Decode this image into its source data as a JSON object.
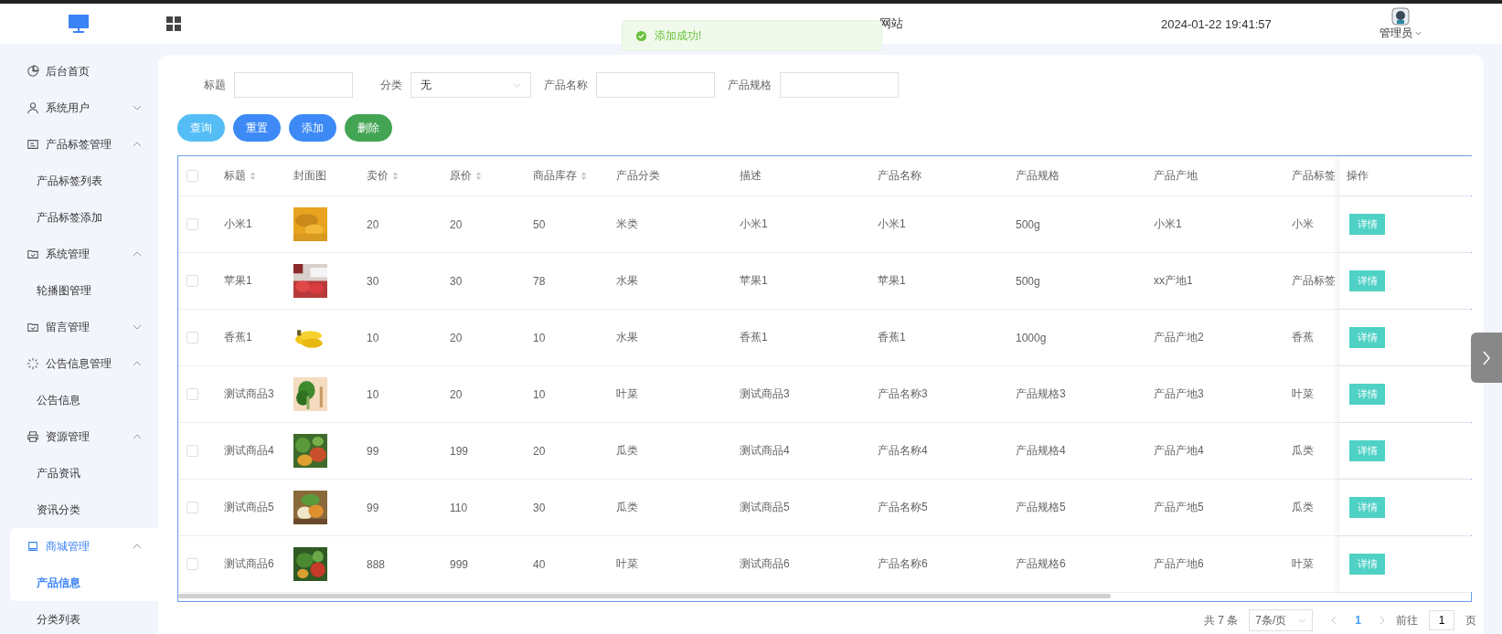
{
  "header": {
    "site_title": "网站",
    "datetime": "2024-01-22 19:41:57",
    "user": "管理员"
  },
  "toast": {
    "message": "添加成功!"
  },
  "sidebar": {
    "items": [
      {
        "label": "后台首页",
        "selected": false
      },
      {
        "label": "系统用户",
        "selected": false,
        "expanded": false
      },
      {
        "label": "产品标签管理",
        "selected": false,
        "expanded": true,
        "children": [
          {
            "label": "产品标签列表",
            "selected": false
          },
          {
            "label": "产品标签添加",
            "selected": false
          }
        ]
      },
      {
        "label": "系统管理",
        "selected": false,
        "expanded": true,
        "children": [
          {
            "label": "轮播图管理",
            "selected": false
          }
        ]
      },
      {
        "label": "留言管理",
        "selected": false,
        "expanded": false
      },
      {
        "label": "公告信息管理",
        "selected": false,
        "expanded": true,
        "children": [
          {
            "label": "公告信息",
            "selected": false
          }
        ]
      },
      {
        "label": "资源管理",
        "selected": false,
        "expanded": true,
        "children": [
          {
            "label": "产品资讯",
            "selected": false
          },
          {
            "label": "资讯分类",
            "selected": false
          }
        ]
      },
      {
        "label": "商城管理",
        "selected": true,
        "expanded": true,
        "children": [
          {
            "label": "产品信息",
            "selected": true
          },
          {
            "label": "分类列表",
            "selected": false
          }
        ]
      }
    ]
  },
  "filters": [
    {
      "kind": "input",
      "label": "标题"
    },
    {
      "kind": "select",
      "label": "分类",
      "value": "无"
    },
    {
      "kind": "input",
      "label": "产品名称"
    },
    {
      "kind": "input",
      "label": "产品规格"
    }
  ],
  "buttons": [
    {
      "label": "查询",
      "kind": "search"
    },
    {
      "label": "重置",
      "kind": "reset"
    },
    {
      "label": "添加",
      "kind": "add"
    },
    {
      "label": "删除",
      "kind": "delete"
    }
  ],
  "table": {
    "all_checked": false,
    "columns": [
      {
        "label": "标题",
        "sortable": true
      },
      {
        "label": "封面图",
        "sortable": false
      },
      {
        "label": "卖价",
        "sortable": true
      },
      {
        "label": "原价",
        "sortable": true
      },
      {
        "label": "商品库存",
        "sortable": true
      },
      {
        "label": "产品分类",
        "sortable": false
      },
      {
        "label": "描述",
        "sortable": false
      },
      {
        "label": "产品名称",
        "sortable": false
      },
      {
        "label": "产品规格",
        "sortable": false
      },
      {
        "label": "产品产地",
        "sortable": false
      },
      {
        "label": "产品标签",
        "sortable": false
      },
      {
        "label": "操作",
        "sortable": false
      }
    ],
    "rows": [
      {
        "checked": false,
        "cells": [
          "小米1",
          {
            "kind": "picture"
          },
          "20",
          "20",
          "50",
          "米类",
          "小米1",
          "小米1",
          "500g",
          "小米1",
          "小米"
        ],
        "action": "详情"
      },
      {
        "checked": false,
        "cells": [
          "苹果1",
          {
            "kind": "picture"
          },
          "30",
          "30",
          "78",
          "水果",
          "苹果1",
          "苹果1",
          "500g",
          "xx产地1",
          "产品标签"
        ],
        "action": "详情"
      },
      {
        "checked": false,
        "cells": [
          "香蕉1",
          {
            "kind": "picture"
          },
          "10",
          "20",
          "10",
          "水果",
          "香蕉1",
          "香蕉1",
          "1000g",
          "产品产地2",
          "香蕉"
        ],
        "action": "详情"
      },
      {
        "checked": false,
        "cells": [
          "测试商品3",
          {
            "kind": "picture"
          },
          "10",
          "20",
          "10",
          "叶菜",
          "测试商品3",
          "产品名称3",
          "产品规格3",
          "产品产地3",
          "叶菜"
        ],
        "action": "详情"
      },
      {
        "checked": false,
        "cells": [
          "测试商品4",
          {
            "kind": "picture"
          },
          "99",
          "199",
          "20",
          "瓜类",
          "测试商品4",
          "产品名称4",
          "产品规格4",
          "产品产地4",
          "瓜类"
        ],
        "action": "详情"
      },
      {
        "checked": false,
        "cells": [
          "测试商品5",
          {
            "kind": "picture"
          },
          "99",
          "110",
          "30",
          "瓜类",
          "测试商品5",
          "产品名称5",
          "产品规格5",
          "产品产地5",
          "瓜类"
        ],
        "action": "详情"
      },
      {
        "checked": false,
        "cells": [
          "测试商品6",
          {
            "kind": "picture"
          },
          "888",
          "999",
          "40",
          "叶菜",
          "测试商品6",
          "产品名称6",
          "产品规格6",
          "产品产地6",
          "叶菜"
        ],
        "action": "详情"
      }
    ]
  },
  "pagination": {
    "total": "共 7 条",
    "page_size": "7条/页",
    "pages": [
      {
        "label": "1",
        "selected": true
      }
    ],
    "goto_label": "前往",
    "goto_value": "1",
    "goto_suffix": "页"
  }
}
